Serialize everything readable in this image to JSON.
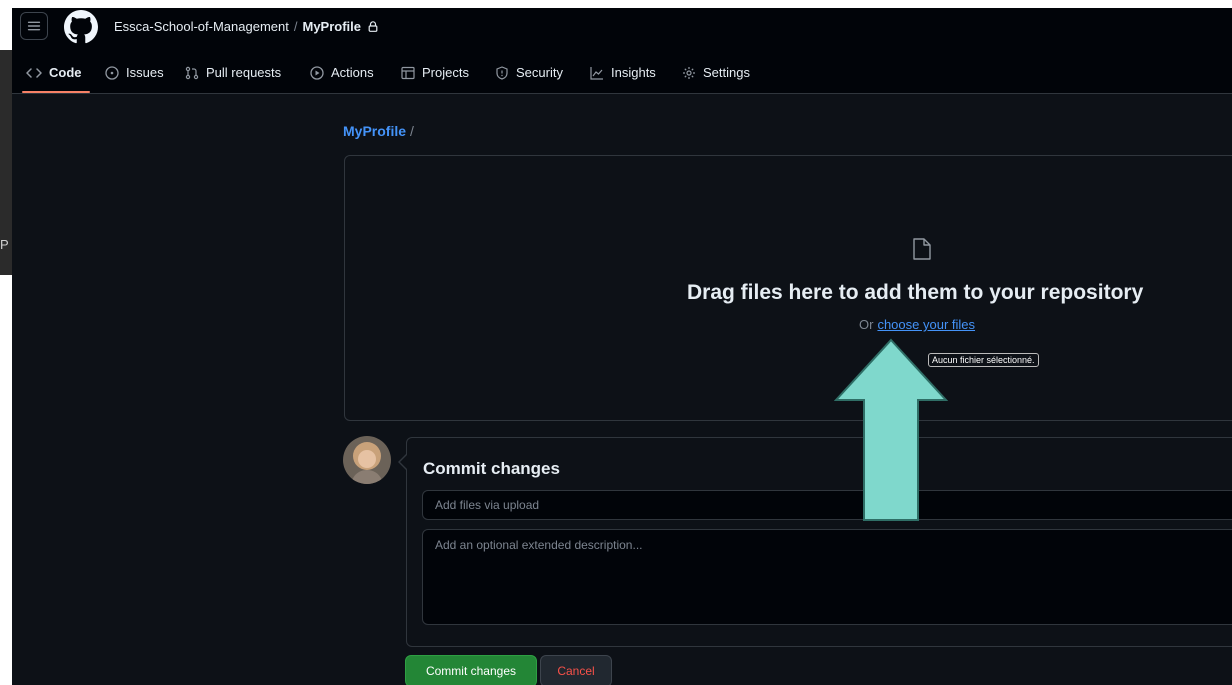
{
  "background": {
    "partial_text": "P"
  },
  "header": {
    "org": "Essca-School-of-Management",
    "separator": "/",
    "repo": "MyProfile"
  },
  "tabs": [
    {
      "label": "Code",
      "icon": "code-icon",
      "active": true
    },
    {
      "label": "Issues",
      "icon": "issue-icon"
    },
    {
      "label": "Pull requests",
      "icon": "pull-request-icon"
    },
    {
      "label": "Actions",
      "icon": "play-icon"
    },
    {
      "label": "Projects",
      "icon": "table-icon"
    },
    {
      "label": "Security",
      "icon": "shield-icon"
    },
    {
      "label": "Insights",
      "icon": "graph-icon"
    },
    {
      "label": "Settings",
      "icon": "gear-icon"
    }
  ],
  "upload": {
    "path_repo": "MyProfile",
    "path_sep": "/",
    "drag_title": "Drag files here to add them to your repository",
    "or_text": "Or",
    "choose_link": "choose your files",
    "tooltip": "Aucun fichier sélectionné."
  },
  "commit": {
    "title": "Commit changes",
    "summary_placeholder": "Add files via upload",
    "description_placeholder": "Add an optional extended description...",
    "commit_button": "Commit changes",
    "cancel_button": "Cancel"
  },
  "colors": {
    "accent": "#f78166",
    "link": "#4493f8",
    "commit_green": "#238636",
    "cancel_red": "#f85149",
    "annotation_arrow": "#7fd8cc"
  }
}
